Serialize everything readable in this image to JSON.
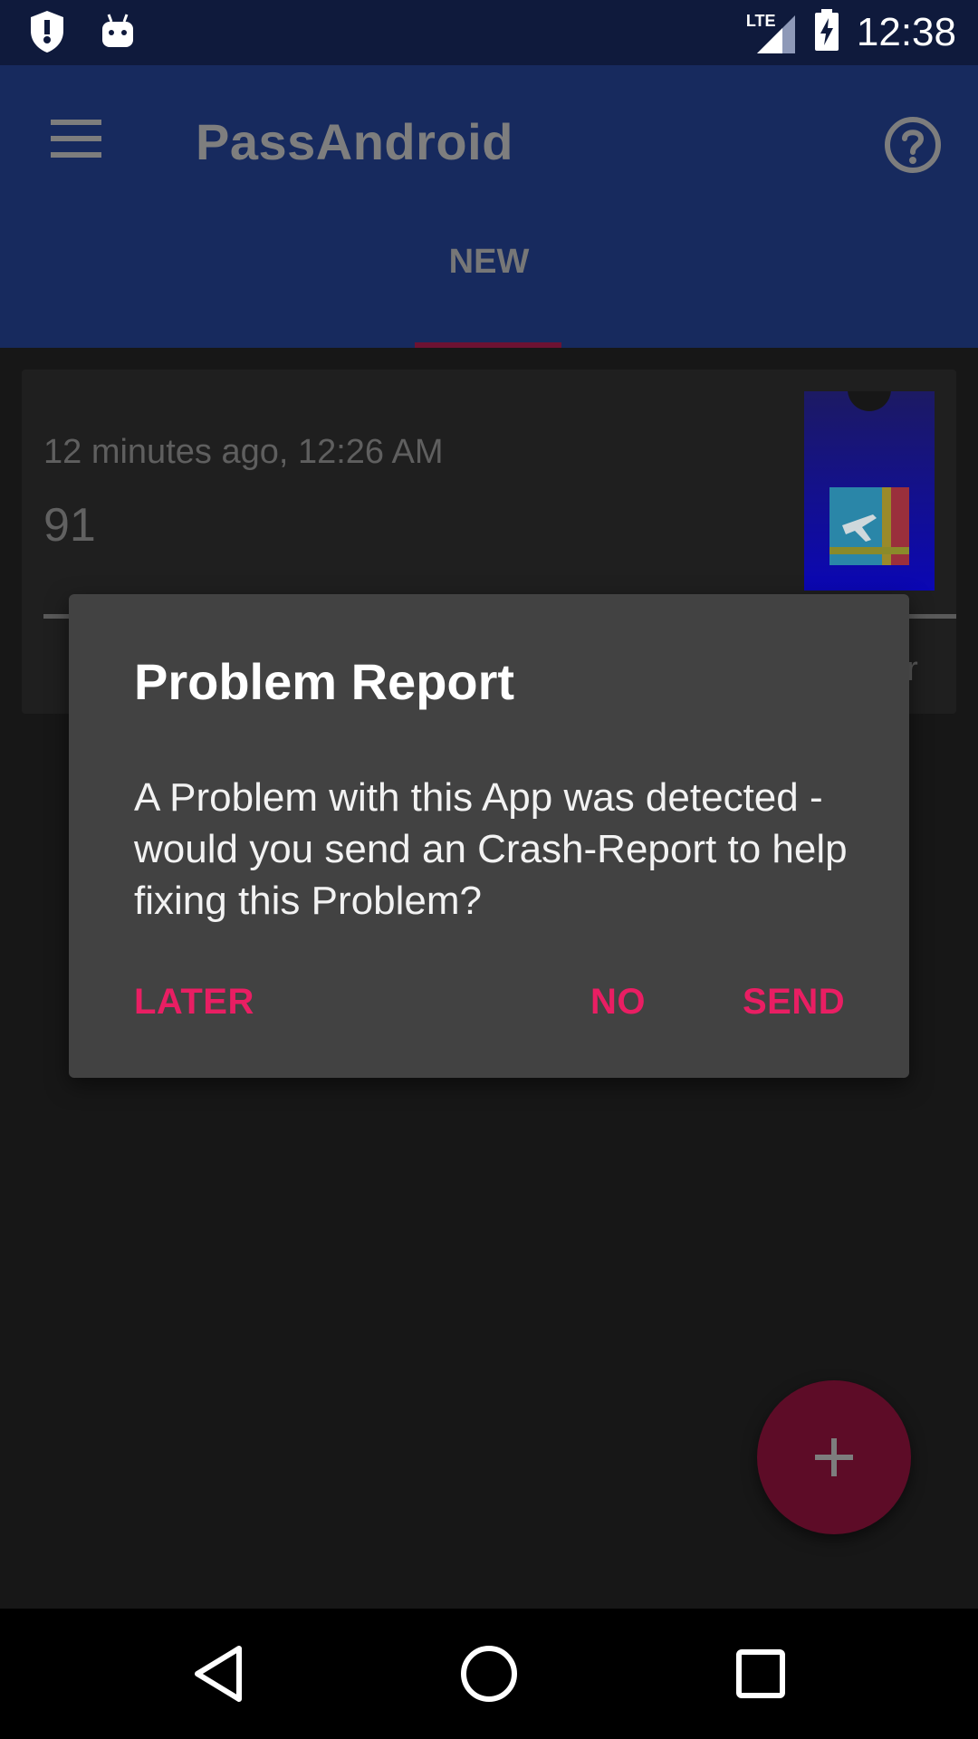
{
  "status_bar": {
    "time": "12:38",
    "network_label": "LTE",
    "icons": [
      "shield-alert-icon",
      "android-debug-icon",
      "lte-signal-icon",
      "battery-charging-icon"
    ]
  },
  "app_bar": {
    "title": "PassAndroid",
    "menu_icon": "hamburger-menu-icon",
    "help_icon": "help-circle-icon",
    "tabs": [
      {
        "label": "NEW",
        "selected": true
      }
    ]
  },
  "pass_card": {
    "time_text": "12 minutes ago, 12:26 AM",
    "number_text": "91",
    "obscured_text_fragment": "ar",
    "thumbnail_icon": "boarding-pass-icon"
  },
  "dialog": {
    "title": "Problem Report",
    "message": "A Problem with this App was detected - would you send an Crash-Report to help fixing this Problem?",
    "buttons": {
      "later": "LATER",
      "no": "NO",
      "send": "SEND"
    }
  },
  "fab": {
    "icon": "plus-icon"
  },
  "nav_bar": {
    "icons": [
      "back-triangle-icon",
      "home-circle-icon",
      "recents-square-icon"
    ]
  },
  "colors": {
    "accent": "#e91e63",
    "app_bar": "#172a5e",
    "status_bar": "#0f1a3c",
    "dialog": "#424242",
    "background": "#171717"
  }
}
